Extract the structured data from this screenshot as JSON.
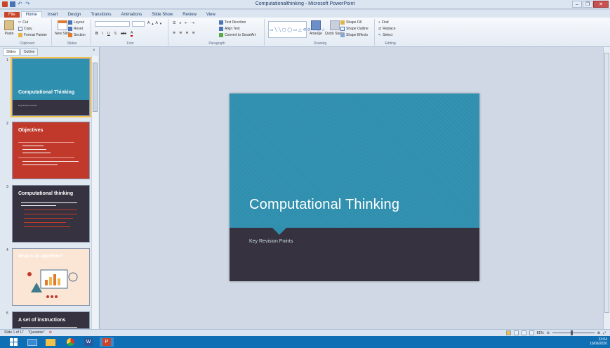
{
  "window": {
    "title": "Computationalthinking - Microsoft PowerPoint"
  },
  "tabs": [
    "File",
    "Home",
    "Insert",
    "Design",
    "Transitions",
    "Animations",
    "Slide Show",
    "Review",
    "View"
  ],
  "ribbon": {
    "clipboard": {
      "label": "Clipboard",
      "paste": "Paste",
      "cut": "Cut",
      "copy": "Copy",
      "format_painter": "Format Painter"
    },
    "slides": {
      "label": "Slides",
      "new_slide": "New Slide",
      "layout": "Layout",
      "reset": "Reset",
      "section": "Section"
    },
    "font": {
      "label": "Font",
      "bold": "B",
      "italic": "I",
      "underline": "U",
      "shadow": "S",
      "strike": "abc"
    },
    "paragraph": {
      "label": "Paragraph",
      "text_direction": "Text Direction",
      "align_text": "Align Text",
      "convert_smartart": "Convert to SmartArt"
    },
    "drawing": {
      "label": "Drawing",
      "arrange": "Arrange",
      "quick_styles": "Quick Styles",
      "shape_fill": "Shape Fill",
      "shape_outline": "Shape Outline",
      "shape_effects": "Shape Effects"
    },
    "editing": {
      "label": "Editing",
      "find": "Find",
      "replace": "Replace",
      "select": "Select"
    }
  },
  "pane": {
    "tabs": [
      "Slides",
      "Outline"
    ],
    "close": "×",
    "thumbnails": [
      {
        "num": "1",
        "title": "Computational Thinking",
        "sub": "Key Revision Points"
      },
      {
        "num": "2",
        "title": "Objectives"
      },
      {
        "num": "3",
        "title": "Computational thinking"
      },
      {
        "num": "4",
        "title": "What is an algorithm?"
      },
      {
        "num": "5",
        "title": "A set of instructions"
      }
    ]
  },
  "slide": {
    "title": "Computational Thinking",
    "subtitle": "Key Revision Points"
  },
  "status": {
    "slide_info": "Slide 1 of 17",
    "theme": "\"Quotable\"",
    "zoom": "81%"
  },
  "tray": {
    "time": "23:04",
    "date": "10/06/2020"
  },
  "colors": {
    "slide_teal": "#2f8fae",
    "slide_dark": "#36323f",
    "file_tab": "#c9452a",
    "taskbar": "#0f6fb5"
  }
}
